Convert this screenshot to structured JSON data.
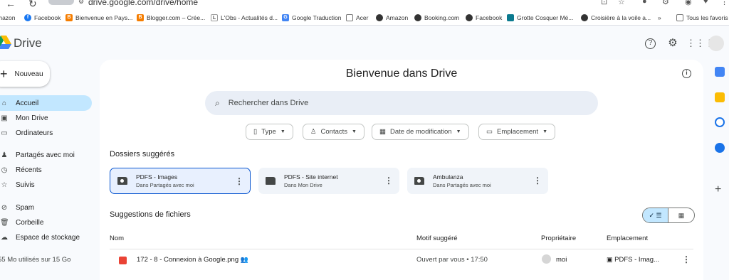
{
  "browser": {
    "url": "drive.google.com/drive/home"
  },
  "bookmarks": [
    {
      "label": "mazon",
      "icon": "amazon-icon",
      "color": "#ff9900"
    },
    {
      "label": "Facebook",
      "icon": "facebook-icon",
      "color": "#1877f2"
    },
    {
      "label": "Bienvenue en Pays...",
      "icon": "blogger-icon",
      "color": "#f57d00"
    },
    {
      "label": "Blogger.com – Crée...",
      "icon": "blogger-icon",
      "color": "#f57d00"
    },
    {
      "label": "L'Obs - Actualités d...",
      "icon": "obs-icon",
      "color": "#555555"
    },
    {
      "label": "Google Traduction",
      "icon": "translate-icon",
      "color": "#4285f4"
    },
    {
      "label": "Acer",
      "icon": "folder-icon",
      "color": "#555555"
    },
    {
      "label": "Amazon",
      "icon": "globe-icon",
      "color": "#333333"
    },
    {
      "label": "Booking.com",
      "icon": "globe-icon",
      "color": "#333333"
    },
    {
      "label": "Facebook",
      "icon": "globe-icon",
      "color": "#333333"
    },
    {
      "label": "Grotte Cosquer Mé...",
      "icon": "grotte-icon",
      "color": "#0b7a8f"
    },
    {
      "label": "Croisière à la voile a...",
      "icon": "globe-icon",
      "color": "#333333"
    },
    {
      "label": "Tous les favoris",
      "icon": "folder-icon",
      "color": "#555555"
    }
  ],
  "header": {
    "title": "Drive"
  },
  "sidebar": {
    "new_label": "Nouveau",
    "items": [
      {
        "label": "Accueil",
        "icon": "home-icon",
        "active": true
      },
      {
        "label": "Mon Drive",
        "icon": "drive-icon"
      },
      {
        "label": "Ordinateurs",
        "icon": "computer-icon"
      },
      {
        "label": "Partagés avec moi",
        "icon": "shared-icon"
      },
      {
        "label": "Récents",
        "icon": "clock-icon"
      },
      {
        "label": "Suivis",
        "icon": "star-icon"
      },
      {
        "label": "Spam",
        "icon": "spam-icon"
      },
      {
        "label": "Corbeille",
        "icon": "trash-icon"
      },
      {
        "label": "Espace de stockage",
        "icon": "cloud-icon"
      }
    ],
    "storage_text": "55 Mo utilisés sur 15 Go"
  },
  "main": {
    "welcome": "Bienvenue dans Drive",
    "search_placeholder": "Rechercher dans Drive",
    "filters": [
      {
        "label": "Type",
        "icon": "doc-icon"
      },
      {
        "label": "Contacts",
        "icon": "person-icon"
      },
      {
        "label": "Date de modification",
        "icon": "calendar-icon"
      },
      {
        "label": "Emplacement",
        "icon": "folder-icon"
      }
    ],
    "suggested_folders_title": "Dossiers suggérés",
    "folders": [
      {
        "name": "PDFS - Images",
        "location": "Dans Partagés avec moi",
        "shared": true
      },
      {
        "name": "PDFS - Site internet",
        "location": "Dans Mon Drive",
        "shared": false
      },
      {
        "name": "Ambulanza",
        "location": "Dans Partagés avec moi",
        "shared": true
      }
    ],
    "suggested_files_title": "Suggestions de fichiers",
    "columns": [
      "Nom",
      "Motif suggéré",
      "Propriétaire",
      "Emplacement"
    ],
    "files": [
      {
        "name": "172 - 8 - Connexion à Google.png",
        "reason": "Ouvert par vous • 17:50",
        "owner": "moi",
        "location": "PDFS - Imag..."
      }
    ]
  }
}
